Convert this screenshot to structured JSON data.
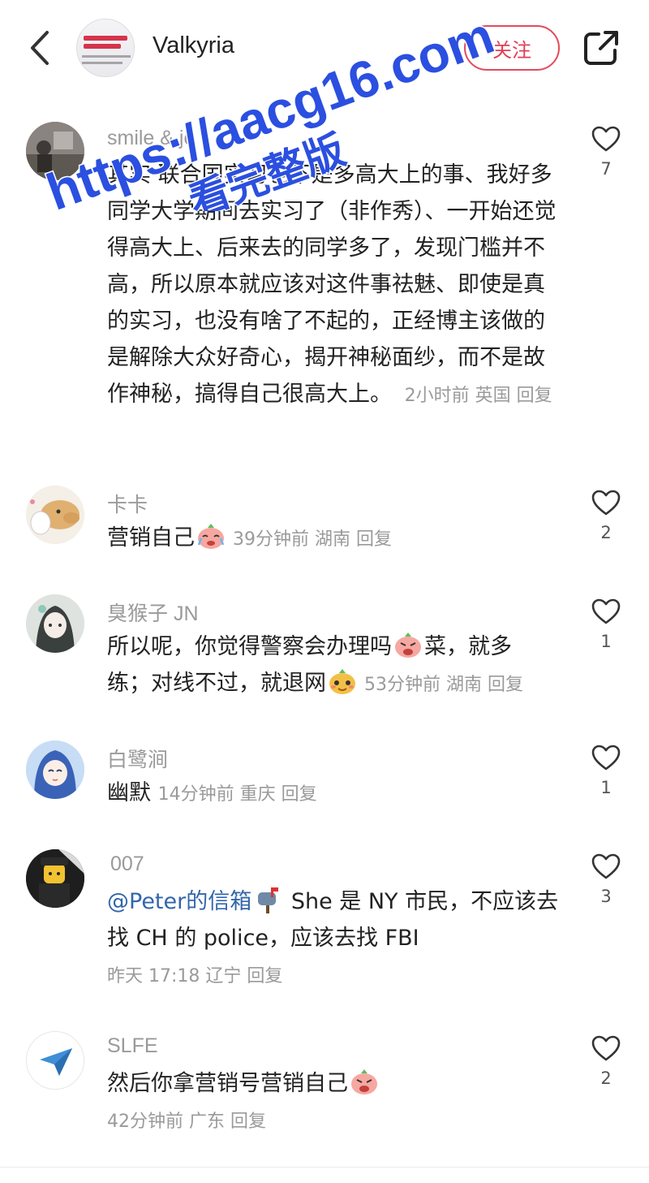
{
  "header": {
    "username": "Valkyria",
    "follow_label": "关注",
    "avatar_text": "Phone 999 now for an ambulance"
  },
  "watermark": {
    "line1": "https://aacg16.com",
    "line2": "看完整版"
  },
  "comments": [
    {
      "user": "smile & jo",
      "text": "其实 联合国实习也不是多高大上的事、我好多同学大学期间去实习了（非作秀）、一开始还觉得高大上、后来去的同学多了，发现门槛并不高，所以原本就应该对这件事祛魅、即使是真的实习，也没有啥了不起的，正经博主该做的是解除大众好奇心，揭开神秘面纱，而不是故作神秘，搞得自己很高大上。",
      "time": "2小时前",
      "location": "英国",
      "reply_label": "回复",
      "likes": "7"
    },
    {
      "user": "卡卡",
      "text": "营销自己",
      "time": "39分钟前",
      "location": "湖南",
      "reply_label": "回复",
      "likes": "2"
    },
    {
      "user": "臭猴子 JN",
      "text_part1": "所以呢，你觉得警察会办理吗",
      "text_part2": "菜，就多练；对线不过，就退网",
      "time": "53分钟前",
      "location": "湖南",
      "reply_label": "回复",
      "likes": "1"
    },
    {
      "user": "白鹭涧",
      "text": "幽默",
      "time": "14分钟前",
      "location": "重庆",
      "reply_label": "回复",
      "likes": "1"
    },
    {
      "user": "007",
      "mention": "@Peter的信箱",
      "text": "She 是 NY 市民，不应该去找 CH 的 police，应该去找 FBI",
      "time": "昨天 17:18",
      "location": "辽宁",
      "reply_label": "回复",
      "likes": "3"
    },
    {
      "user": "SLFE",
      "text": "然后你拿营销号营销自己",
      "time": "42分钟前",
      "location": "广东",
      "reply_label": "回复",
      "likes": "2"
    }
  ],
  "colors": {
    "accent": "#e23d54",
    "watermark": "#2b4fe0",
    "muted": "#9a9a9a",
    "mention": "#3366aa"
  }
}
